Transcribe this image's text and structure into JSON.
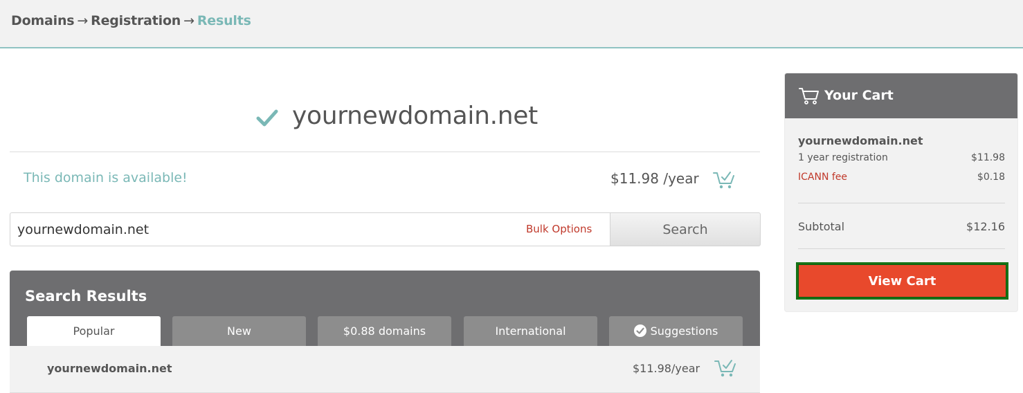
{
  "breadcrumb": {
    "items": [
      "Domains",
      "Registration"
    ],
    "separator": "→",
    "current": "Results"
  },
  "domain": {
    "name": "yournewdomain.net",
    "availability": "This domain is available!",
    "price": "$11.98 /year"
  },
  "search": {
    "value": "yournewdomain.net",
    "bulk_label": "Bulk Options",
    "button_label": "Search"
  },
  "results": {
    "heading": "Search Results",
    "tabs": [
      "Popular",
      "New",
      "$0.88 domains",
      "International",
      "Suggestions"
    ],
    "active_tab": "Popular",
    "rows": [
      {
        "name": "yournewdomain.net",
        "price": "$11.98/year"
      }
    ]
  },
  "cart": {
    "title": "Your Cart",
    "item_name": "yournewdomain.net",
    "lines": [
      {
        "label": "1 year registration",
        "value": "$11.98"
      },
      {
        "label": "ICANN fee",
        "value": "$0.18"
      }
    ],
    "subtotal_label": "Subtotal",
    "subtotal_value": "$12.16",
    "view_cart_label": "View Cart"
  },
  "colors": {
    "accent_teal": "#7ab8b6",
    "header_gray": "#6e6e70",
    "cta_red": "#e8492c",
    "cta_outline": "#177317",
    "link_red": "#c0392b"
  },
  "icons": [
    "check-icon",
    "cart-add-icon",
    "cart-icon",
    "check-circle-icon"
  ]
}
